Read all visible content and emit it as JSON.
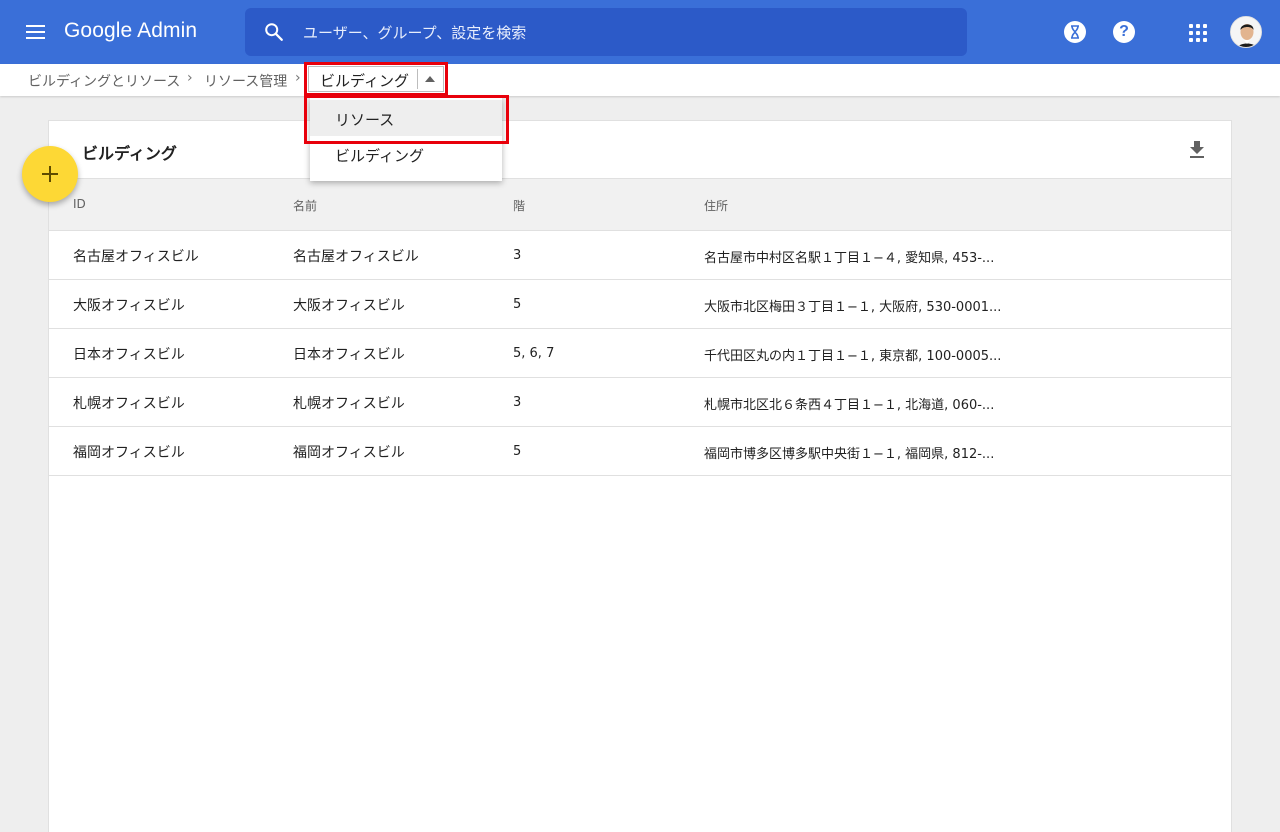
{
  "app": {
    "brand": "Google Admin",
    "search_placeholder": "ユーザー、グループ、設定を検索"
  },
  "breadcrumb": {
    "items": [
      "ビルディングとリソース",
      "リソース管理"
    ],
    "separator": "›",
    "current_select": "ビルディング"
  },
  "dropdown": {
    "options": [
      "リソース",
      "ビルディング"
    ]
  },
  "card": {
    "title": "ビルディング",
    "columns": [
      "ID",
      "名前",
      "階",
      "住所"
    ],
    "rows": [
      {
        "id": "名古屋オフィスビル",
        "name": "名古屋オフィスビル",
        "floors": "3",
        "address": "名古屋市中村区名駅１丁目１−４, 愛知県, 453-..."
      },
      {
        "id": "大阪オフィスビル",
        "name": "大阪オフィスビル",
        "floors": "5",
        "address": "大阪市北区梅田３丁目１−１, 大阪府, 530-0001..."
      },
      {
        "id": "日本オフィスビル",
        "name": "日本オフィスビル",
        "floors": "5, 6, 7",
        "address": "千代田区丸の内１丁目１−１, 東京都, 100-0005..."
      },
      {
        "id": "札幌オフィスビル",
        "name": "札幌オフィスビル",
        "floors": "3",
        "address": "札幌市北区北６条西４丁目１−１, 北海道, 060-..."
      },
      {
        "id": "福岡オフィスビル",
        "name": "福岡オフィスビル",
        "floors": "5",
        "address": "福岡市博多区博多駅中央街１−１, 福岡県, 812-..."
      }
    ]
  },
  "icons": {
    "menu": "hamburger-icon",
    "search": "search-icon",
    "hourglass": "hourglass-icon",
    "help": "help-icon",
    "apps": "apps-grid-icon",
    "download": "download-icon",
    "add": "plus-icon"
  },
  "colors": {
    "appbar": "#3a6fd8",
    "searchbar": "#2c5ac8",
    "fab": "#fdd835",
    "highlight": "#e8000b"
  },
  "help_glyph": "?"
}
